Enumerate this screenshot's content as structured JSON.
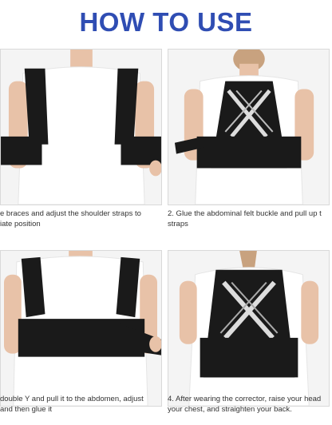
{
  "header": {
    "title": "HOW TO USE"
  },
  "steps": [
    {
      "line1": "e braces and adjust the shoulder straps to",
      "line2": "iate position"
    },
    {
      "line1": "2. Glue the abdominal felt buckle and pull up t",
      "line2": "straps"
    },
    {
      "line1": "double Y and pull it to the abdomen, adjust",
      "line2": "and then glue it"
    },
    {
      "line1": "4. After wearing the corrector, raise your head",
      "line2": "your chest, and straighten your back."
    }
  ],
  "colors": {
    "title": "#2f4db3",
    "brace": "#1a1a1a",
    "shirt": "#ffffff",
    "skin": "#e8c2a8"
  }
}
